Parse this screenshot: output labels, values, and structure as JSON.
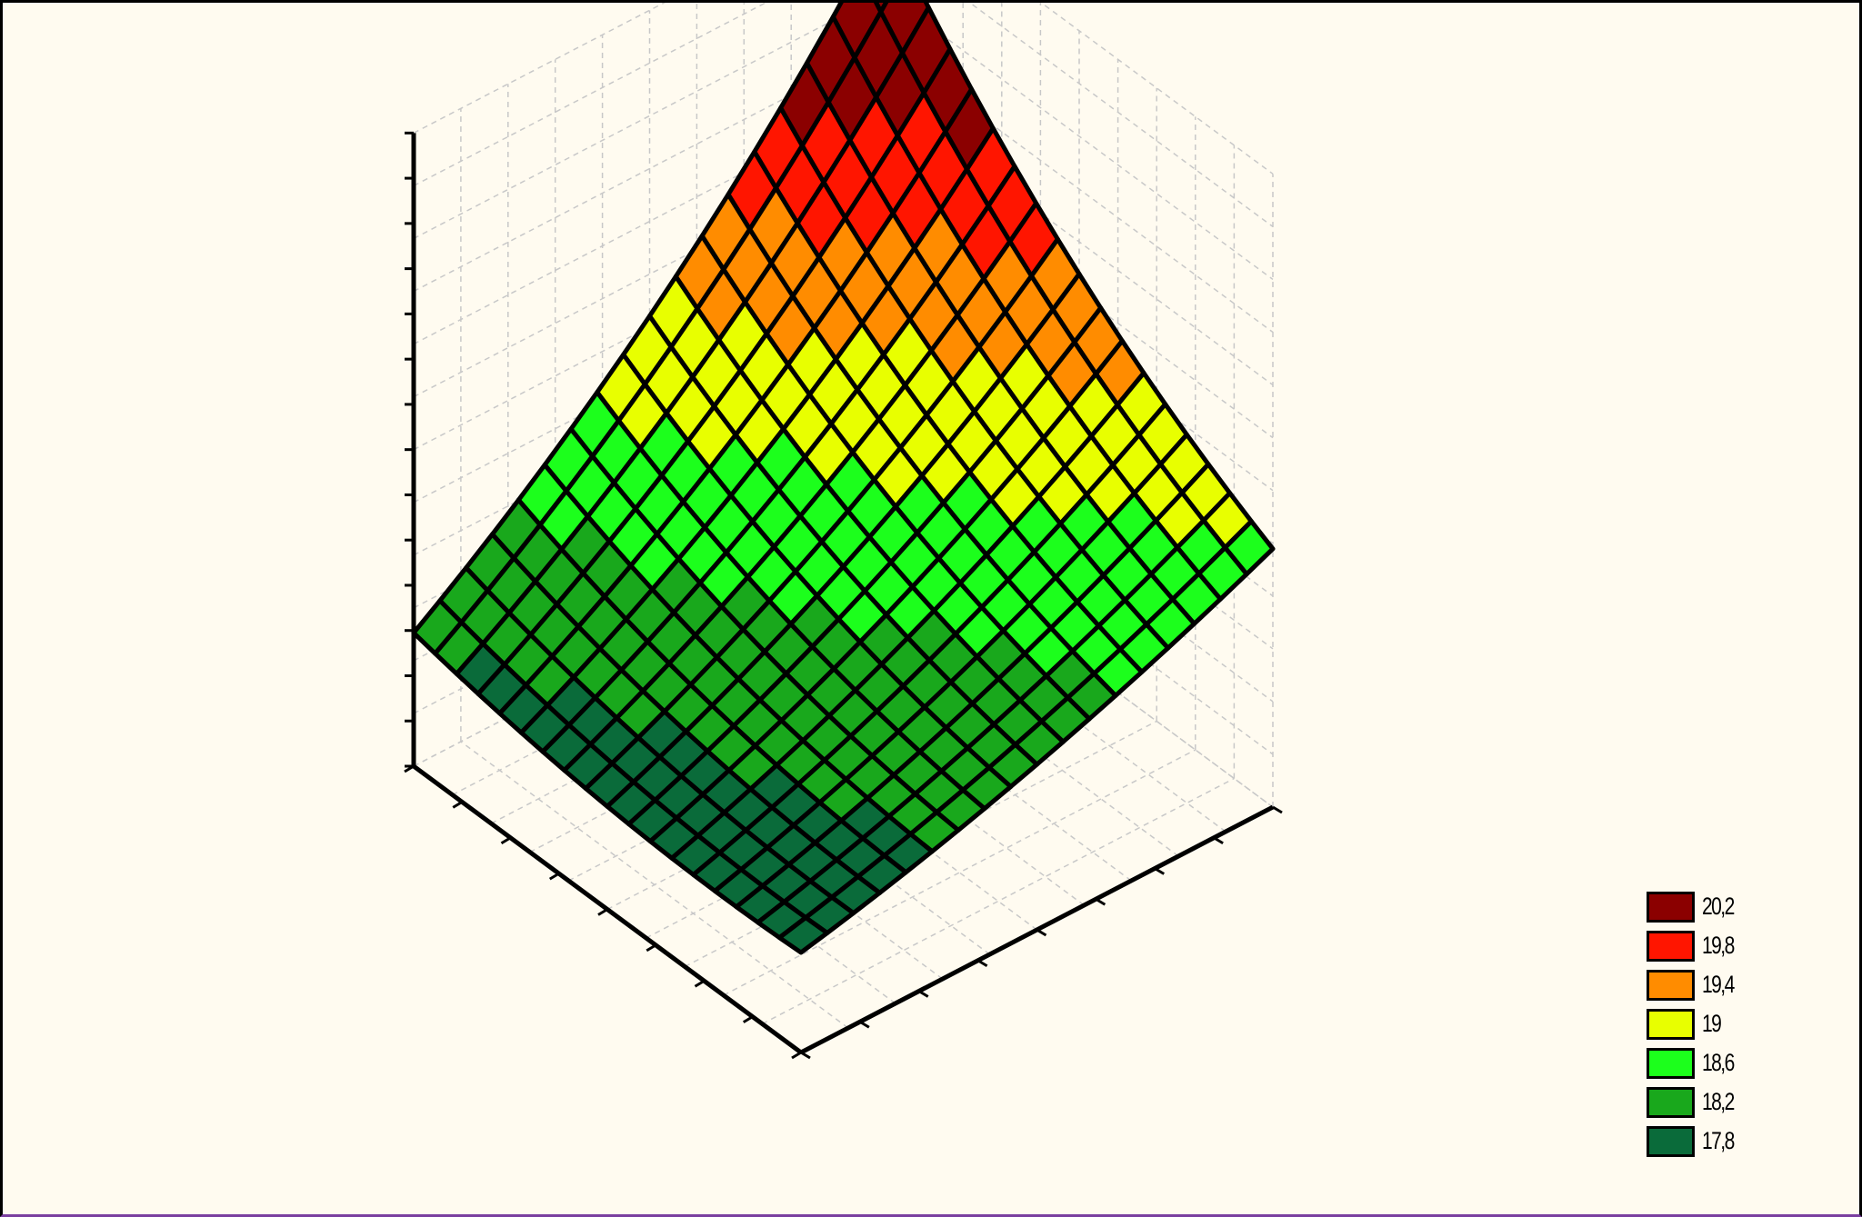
{
  "chart_data": {
    "type": "surface3d",
    "title": "",
    "xlabel": "",
    "ylabel": "",
    "zlabel": "",
    "grid": true,
    "mesh": {
      "rows": 18,
      "cols": 18
    },
    "surface_z_corners": {
      "back": 20.3,
      "left": 18.0,
      "right": 18.75,
      "front": 17.8
    },
    "legend": {
      "placement": "bottom-right",
      "items": [
        {
          "label": "20,2",
          "color": "#8b0000"
        },
        {
          "label": "19,8",
          "color": "#ff1500"
        },
        {
          "label": "19,4",
          "color": "#ff8c00"
        },
        {
          "label": "19",
          "color": "#e8ff00"
        },
        {
          "label": "18,6",
          "color": "#1cff1c"
        },
        {
          "label": "18,2",
          "color": "#19a81c"
        },
        {
          "label": "17,8",
          "color": "#0a6b3a"
        }
      ]
    }
  }
}
